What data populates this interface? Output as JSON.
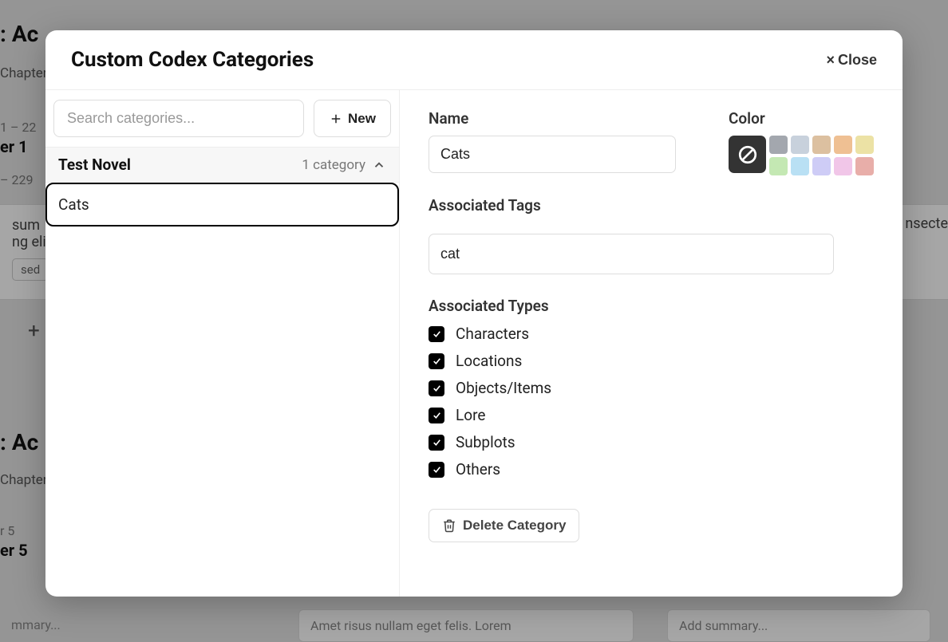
{
  "modal": {
    "title": "Custom Codex Categories",
    "close_label": "Close"
  },
  "left": {
    "search_placeholder": "Search categories...",
    "new_label": "New",
    "novel_title": "Test Novel",
    "category_count": "1 category",
    "categories": [
      {
        "name": "Cats"
      }
    ]
  },
  "right": {
    "name_label": "Name",
    "name_value": "Cats",
    "color_label": "Color",
    "colors_row1": [
      "#A3A7AE",
      "#C8D1DC",
      "#DCC0A0",
      "#EFC093",
      "#ECE2A5"
    ],
    "colors_row2": [
      "#C4E8B3",
      "#B9E0F4",
      "#CECCF6",
      "#F1C6E8",
      "#E8AEA9"
    ],
    "tags_label": "Associated Tags",
    "tags_value": "cat",
    "types_label": "Associated Types",
    "types": [
      {
        "label": "Characters",
        "checked": true
      },
      {
        "label": "Locations",
        "checked": true
      },
      {
        "label": "Objects/Items",
        "checked": true
      },
      {
        "label": "Lore",
        "checked": true
      },
      {
        "label": "Subplots",
        "checked": true
      },
      {
        "label": "Others",
        "checked": true
      }
    ],
    "delete_label": "Delete Category"
  },
  "bg": {
    "act1": ": Ac",
    "chapter": "Chapter",
    "r1": "1 – 22",
    "er1": "er 1",
    "r2": " – 229",
    "ipsum": "sum",
    "elit": "ng elit",
    "sed": "sed",
    "act2": ": Ac",
    "r5": "r 5",
    "er5": "er 5",
    "summary": "mmary...",
    "snippet": "Amet risus nullam eget felis. Lorem",
    "addsummary": "Add summary...",
    "insecte": "nsecte"
  }
}
